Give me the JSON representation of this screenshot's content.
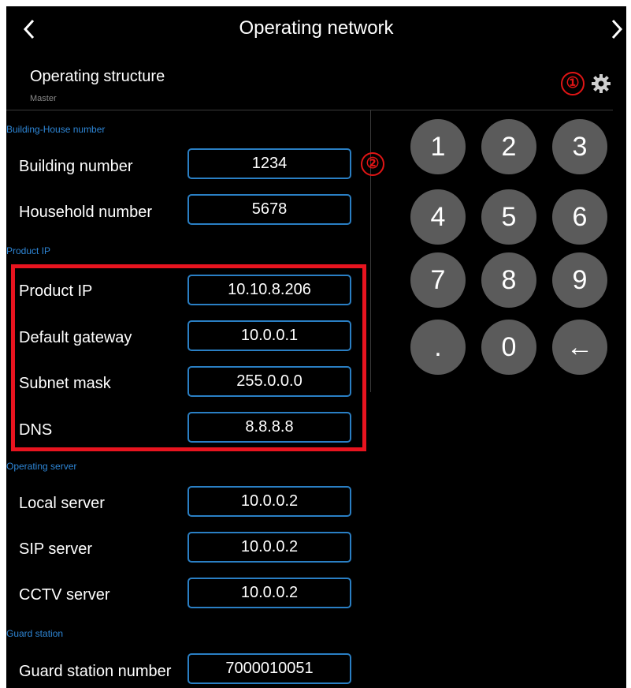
{
  "header": {
    "title": "Operating network"
  },
  "structure": {
    "label": "Operating structure",
    "role": "Master"
  },
  "sections": {
    "building": "Building-House number",
    "product_ip": "Product IP",
    "server": "Operating server",
    "guard": "Guard station"
  },
  "fields": [
    {
      "label": "Building number",
      "value": "1234"
    },
    {
      "label": "Household number",
      "value": "5678"
    },
    {
      "label": "Product IP",
      "value": "10.10.8.206"
    },
    {
      "label": "Default gateway",
      "value": "10.0.0.1"
    },
    {
      "label": "Subnet mask",
      "value": "255.0.0.0"
    },
    {
      "label": "DNS",
      "value": "8.8.8.8"
    },
    {
      "label": "Local server",
      "value": "10.0.0.2"
    },
    {
      "label": "SIP server",
      "value": "10.0.0.2"
    },
    {
      "label": "CCTV server",
      "value": "10.0.0.2"
    },
    {
      "label": "Guard station number",
      "value": "7000010051"
    }
  ],
  "keypad": [
    "1",
    "2",
    "3",
    "4",
    "5",
    "6",
    "7",
    "8",
    "9",
    ".",
    "0",
    "←"
  ],
  "badges": [
    "①",
    "②"
  ],
  "icons": {
    "back": "chevron-left-icon",
    "forward": "chevron-right-icon",
    "settings": "gear-icon",
    "backspace": "arrow-left-icon"
  },
  "colors": {
    "background": "#000000",
    "accent": "#2a7fc4",
    "section": "#2e86d6",
    "key": "#5b5b5b",
    "highlight": "#e8141f"
  }
}
